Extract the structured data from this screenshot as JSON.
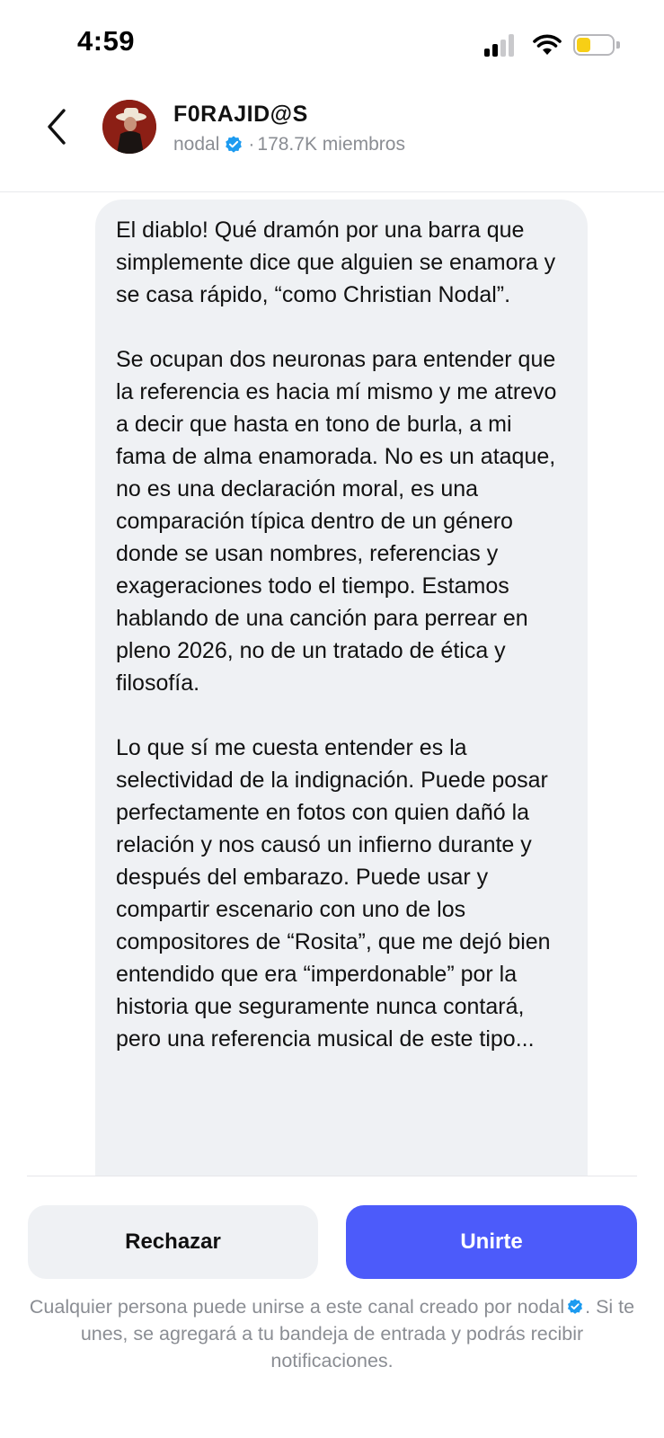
{
  "status_bar": {
    "time": "4:59",
    "icons": [
      "signal-icon",
      "wifi-icon",
      "battery-icon"
    ],
    "battery_color": "#f7cf16"
  },
  "header": {
    "back_icon": "chevron-left-icon",
    "channel_name": "F0RAJID@S",
    "owner": "nodal",
    "verified_icon": "verified-badge-icon",
    "separator": "·",
    "members": "178.7K miembros"
  },
  "message": {
    "paragraphs": [
      "El diablo! Qué dramón por una barra que simplemente dice que alguien se enamora y se casa rápido, “como Christian Nodal”.",
      "Se ocupan dos neuronas para entender que la referencia es hacia mí mismo y me atrevo a decir que hasta en tono de burla, a mi fama de alma enamorada. No es un ataque, no es una declaración moral, es una comparación típica dentro de un género donde se usan nombres, referencias y exageraciones todo el tiempo. Estamos hablando de una canción para perrear en pleno 2026, no de un tratado de ética y filosofía.",
      "Lo que sí me cuesta entender es la selectividad de la indignación. Puede posar perfectamente en fotos con quien dañó la relación y nos causó un infierno durante y después del embarazo. Puede usar y compartir escenario con uno de los compositores de “Rosita”, que me dejó bien entendido que era “imperdonable” por la historia que seguramente nunca contará, pero una referencia musical de este tipo..."
    ]
  },
  "actions": {
    "reject_label": "Rechazar",
    "join_label": "Unirte"
  },
  "footer": {
    "note_start": "Cualquier persona puede unirse a este canal creado por",
    "note_owner": "nodal",
    "note_end": ". Si te unes, se agregará a tu bandeja de entrada y podrás recibir notificaciones."
  },
  "colors": {
    "accent": "#4c5bfa",
    "verified": "#1d9bf0",
    "bubble": "#eff1f4",
    "muted_text": "#8a8d93"
  }
}
